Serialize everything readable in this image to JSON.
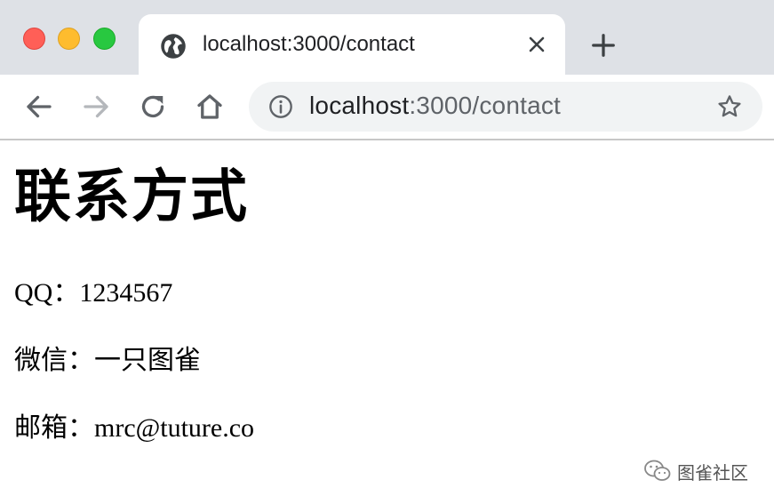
{
  "window": {
    "traffic_lights": [
      "close",
      "minimize",
      "maximize"
    ]
  },
  "tab": {
    "title": "localhost:3000/contact",
    "favicon": "globe-icon"
  },
  "toolbar": {
    "buttons": [
      "back-arrow-icon",
      "forward-arrow-icon",
      "reload-icon",
      "home-icon"
    ],
    "url_host": "localhost",
    "url_rest": ":3000/contact",
    "info_icon": "info-icon",
    "bookmark_icon": "star-icon"
  },
  "page": {
    "title": "联系方式",
    "contacts": [
      {
        "text": "QQ：1234567"
      },
      {
        "text": "微信：一只图雀"
      },
      {
        "text": "邮箱：mrc@tuture.co"
      }
    ]
  },
  "watermark": {
    "text": "图雀社区"
  },
  "colors": {
    "tabstrip_bg": "#dee1e6",
    "omnibox_bg": "#f1f3f4",
    "traffic_close": "#ff5f57",
    "traffic_min": "#febc2e",
    "traffic_max": "#28c840",
    "text_primary": "#202124",
    "text_secondary": "#5f6368"
  }
}
